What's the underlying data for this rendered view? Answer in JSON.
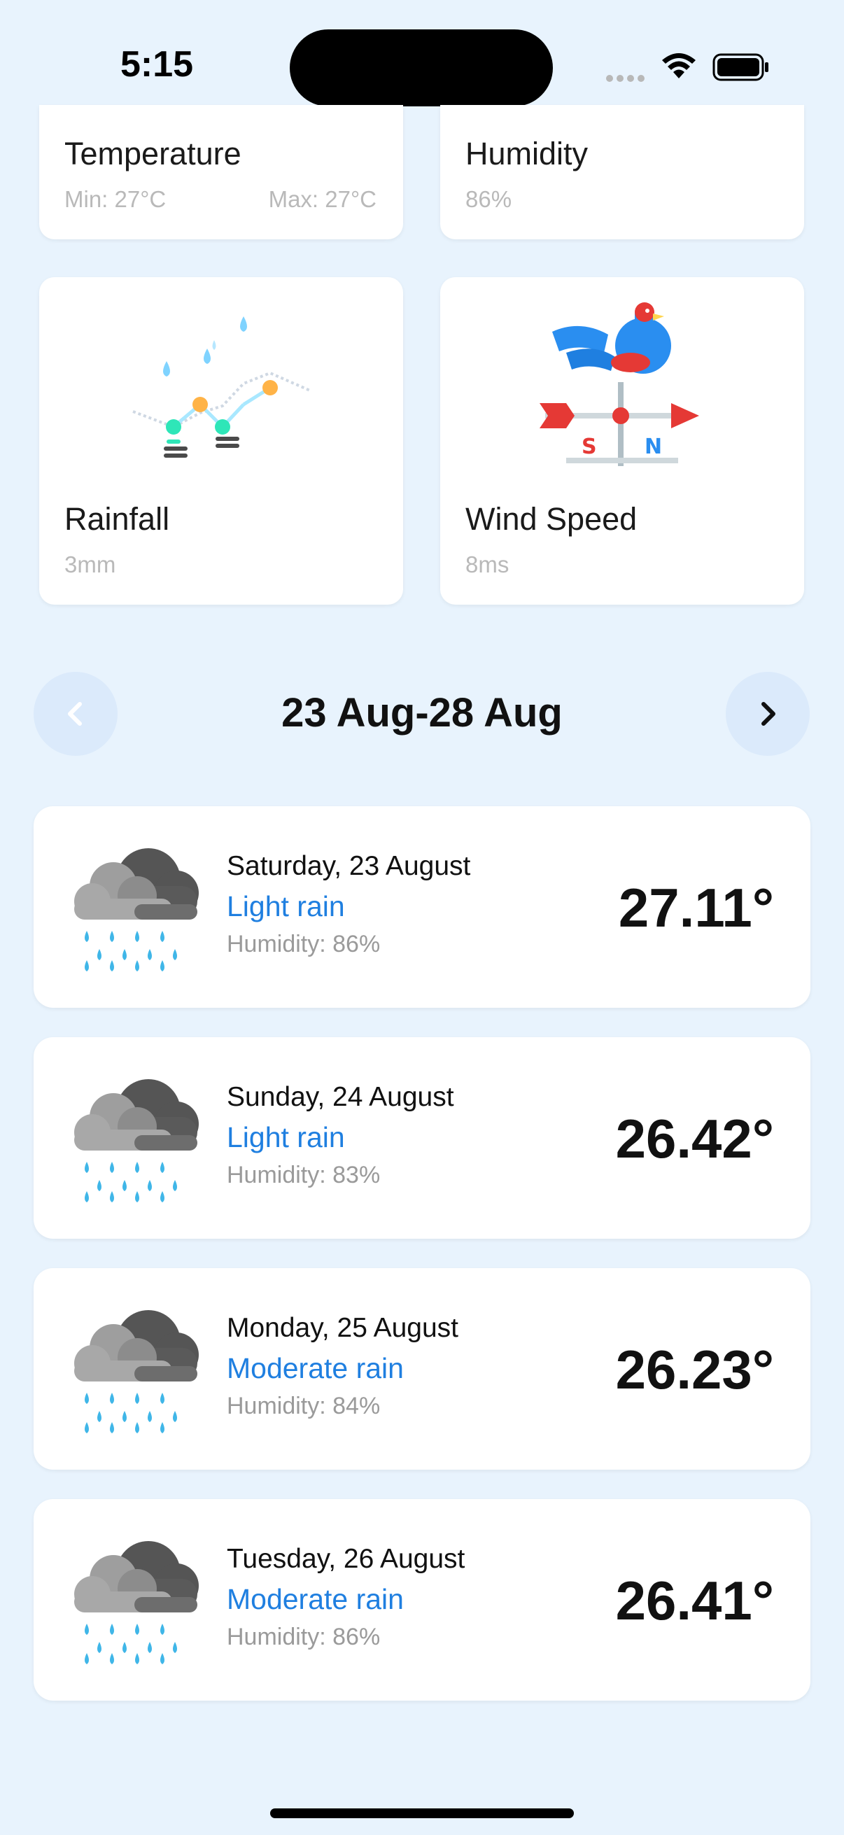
{
  "status_bar": {
    "time": "5:15"
  },
  "stats": {
    "temperature": {
      "title": "Temperature",
      "min": "Min: 27°C",
      "max": "Max: 27°C"
    },
    "humidity": {
      "title": "Humidity",
      "value": "86%"
    },
    "rainfall": {
      "title": "Rainfall",
      "value": "3mm"
    },
    "wind": {
      "title": "Wind Speed",
      "value": "8ms"
    }
  },
  "date_range": "23 Aug-28 Aug",
  "forecast": [
    {
      "date": "Saturday, 23 August",
      "condition": "Light rain",
      "humidity": "Humidity: 86%",
      "temp": "27.11°"
    },
    {
      "date": "Sunday, 24 August",
      "condition": "Light rain",
      "humidity": "Humidity: 83%",
      "temp": "26.42°"
    },
    {
      "date": "Monday, 25 August",
      "condition": "Moderate rain",
      "humidity": "Humidity: 84%",
      "temp": "26.23°"
    },
    {
      "date": "Tuesday, 26 August",
      "condition": "Moderate rain",
      "humidity": "Humidity: 86%",
      "temp": "26.41°"
    }
  ],
  "icons": {
    "rain_cloud": "rain-cloud-icon",
    "rainfall": "rainfall-chart-icon",
    "wind": "weather-vane-icon",
    "prev": "chevron-left-icon",
    "next": "chevron-right-icon"
  },
  "colors": {
    "background": "#e8f3fd",
    "accent": "#1f7fe0",
    "muted": "#9a9a9a"
  }
}
